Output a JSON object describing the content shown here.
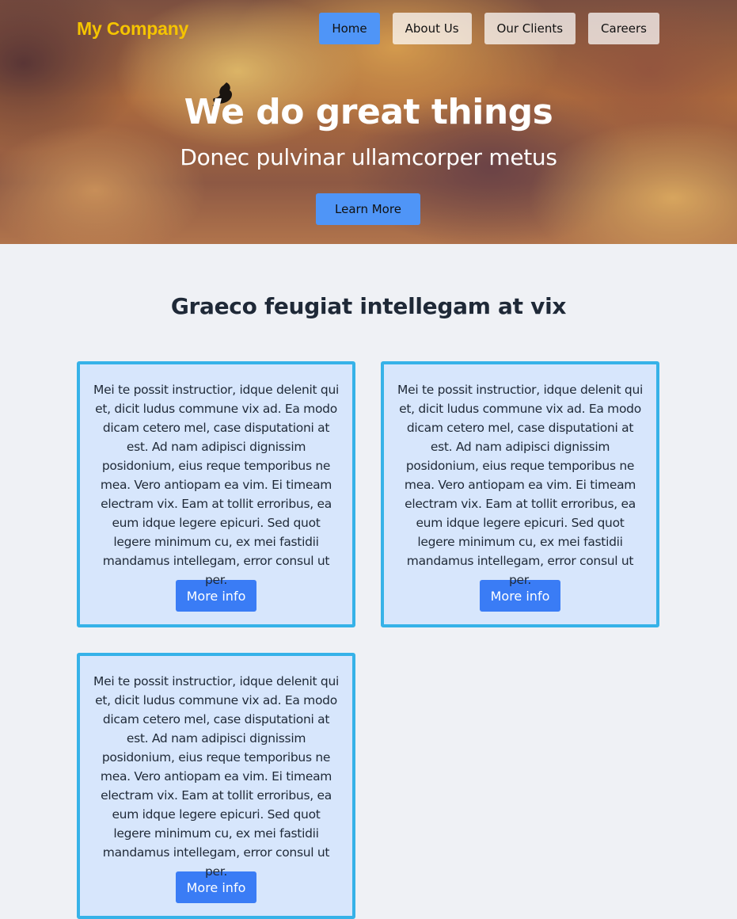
{
  "header": {
    "brand": "My Company",
    "nav": [
      "Home",
      "About Us",
      "Our Clients",
      "Careers"
    ],
    "active_nav": "Home"
  },
  "hero": {
    "title": "We do great things",
    "subtitle": "Donec pulvinar ullamcorper metus",
    "button": "Learn More"
  },
  "section": {
    "title": "Graeco feugiat intellegam at vix"
  },
  "cards": [
    {
      "text": "Mei te possit instructior, idque delenit qui et, dicit ludus commune vix ad. Ea modo dicam cetero mel, case disputationi at est. Ad nam adipisci dignissim posidonium, eius reque temporibus ne mea. Vero antiopam ea vim. Ei timeam electram vix. Eam at tollit erroribus, ea eum idque legere epicuri. Sed quot legere minimum cu, ex mei fastidii mandamus intellegam, error consul ut per.",
      "button": "More info"
    },
    {
      "text": "Mei te possit instructior, idque delenit qui et, dicit ludus commune vix ad. Ea modo dicam cetero mel, case disputationi at est. Ad nam adipisci dignissim posidonium, eius reque temporibus ne mea. Vero antiopam ea vim. Ei timeam electram vix. Eam at tollit erroribus, ea eum idque legere epicuri. Sed quot legere minimum cu, ex mei fastidii mandamus intellegam, error consul ut per.",
      "button": "More info"
    },
    {
      "text": "Mei te possit instructior, idque delenit qui et, dicit ludus commune vix ad. Ea modo dicam cetero mel, case disputationi at est. Ad nam adipisci dignissim posidonium, eius reque temporibus ne mea. Vero antiopam ea vim. Ei timeam electram vix. Eam at tollit erroribus, ea eum idque legere epicuri. Sed quot legere minimum cu, ex mei fastidii mandamus intellegam, error consul ut per.",
      "button": "More info"
    }
  ],
  "colors": {
    "brand": "#f5c400",
    "primary": "#4f95f7",
    "card_bg": "#d7e6fc",
    "card_border": "#36b2e8",
    "card_button": "#3a7cf5"
  }
}
